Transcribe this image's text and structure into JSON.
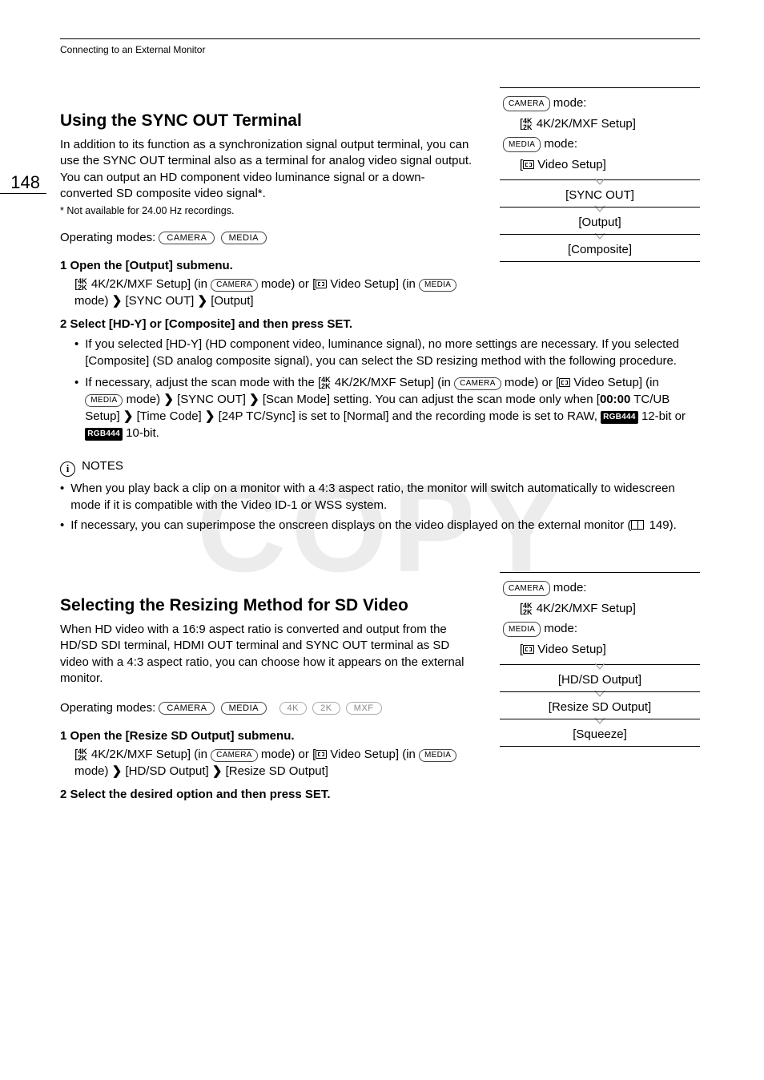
{
  "page_number": "148",
  "header_label": "Connecting to an External Monitor",
  "watermark": "COPY",
  "section1": {
    "heading": "Using the SYNC OUT Terminal",
    "intro": "In addition to its function as a synchronization signal output terminal, you can use the SYNC OUT terminal also as a terminal for analog video signal output. You can output an HD component video luminance signal or a down-converted SD composite video signal*.",
    "footnote": "* Not available for 24.00 Hz recordings.",
    "operating_label": "Operating modes:",
    "op_modes": {
      "camera": "CAMERA",
      "media": "MEDIA"
    },
    "step1": "1 Open the [Output] submenu.",
    "step1_detail_a": "4K/2K/MXF Setup] (in",
    "step1_detail_b": "mode) or [",
    "step1_detail_c": "Video Setup] (in",
    "step1_detail_d": "mode)",
    "step1_detail_e": "[SYNC OUT]",
    "step1_detail_f": "[Output]",
    "step2": "2 Select [HD-Y] or [Composite] and then press SET.",
    "bullet1": "If you selected [HD-Y] (HD component video, luminance signal), no more settings are necessary. If you selected [Composite] (SD analog composite signal), you can select the SD resizing method with the following procedure.",
    "bullet2_a": "If necessary, adjust the scan mode with the [",
    "bullet2_b": "4K/2K/MXF Setup] (in",
    "bullet2_c": "mode) or [",
    "bullet2_d": "Video Setup] (in",
    "bullet2_e": "mode)",
    "bullet2_f": "[SYNC OUT]",
    "bullet2_g": "[Scan Mode] setting. You can adjust the scan mode only when [",
    "bullet2_h": "00:00",
    "bullet2_i": "TC/UB Setup]",
    "bullet2_j": "[Time Code]",
    "bullet2_k": "[24P TC/Sync] is set to [Normal] and the recording mode is set to RAW,",
    "bullet2_l": "12-bit or",
    "bullet2_m": "10-bit.",
    "rgb_badge": "RGB444"
  },
  "sidebox1": {
    "camera_label": "CAMERA",
    "mode_word": "mode:",
    "camera_setup": "4K/2K/MXF Setup]",
    "media_label": "MEDIA",
    "media_setup": "Video Setup]",
    "row1": "[SYNC OUT]",
    "row2": "[Output]",
    "row3": "[Composite]"
  },
  "notes": {
    "label": "NOTES",
    "n1": "When you play back a clip on a monitor with a 4:3 aspect ratio, the monitor will switch automatically to widescreen mode if it is compatible with the Video ID-1 or WSS system.",
    "n2_a": "If necessary, you can superimpose the onscreen displays on the video displayed on the external monitor (",
    "n2_b": "149)."
  },
  "section2": {
    "heading": "Selecting the Resizing Method for SD Video",
    "intro": "When HD video with a 16:9 aspect ratio is converted and output from the HD/SD SDI terminal, HDMI OUT terminal and SYNC OUT terminal as SD video with a 4:3 aspect ratio, you can choose how it appears on the external monitor.",
    "operating_label": "Operating modes:",
    "op_modes": {
      "camera": "CAMERA",
      "media": "MEDIA",
      "k4": "4K",
      "k2": "2K",
      "mxf": "MXF"
    },
    "step1": "1 Open the [Resize SD Output] submenu.",
    "step1_detail_a": "4K/2K/MXF Setup] (in",
    "step1_detail_b": "mode) or [",
    "step1_detail_c": "Video Setup] (in",
    "step1_detail_d": "mode)",
    "step1_detail_e": "[HD/SD Output]",
    "step1_detail_f": "[Resize SD Output]",
    "step2": "2 Select the desired option and then press SET."
  },
  "sidebox2": {
    "camera_label": "CAMERA",
    "mode_word": "mode:",
    "camera_setup": "4K/2K/MXF Setup]",
    "media_label": "MEDIA",
    "media_setup": "Video Setup]",
    "row1": "[HD/SD Output]",
    "row2": "[Resize SD Output]",
    "row3": "[Squeeze]"
  }
}
